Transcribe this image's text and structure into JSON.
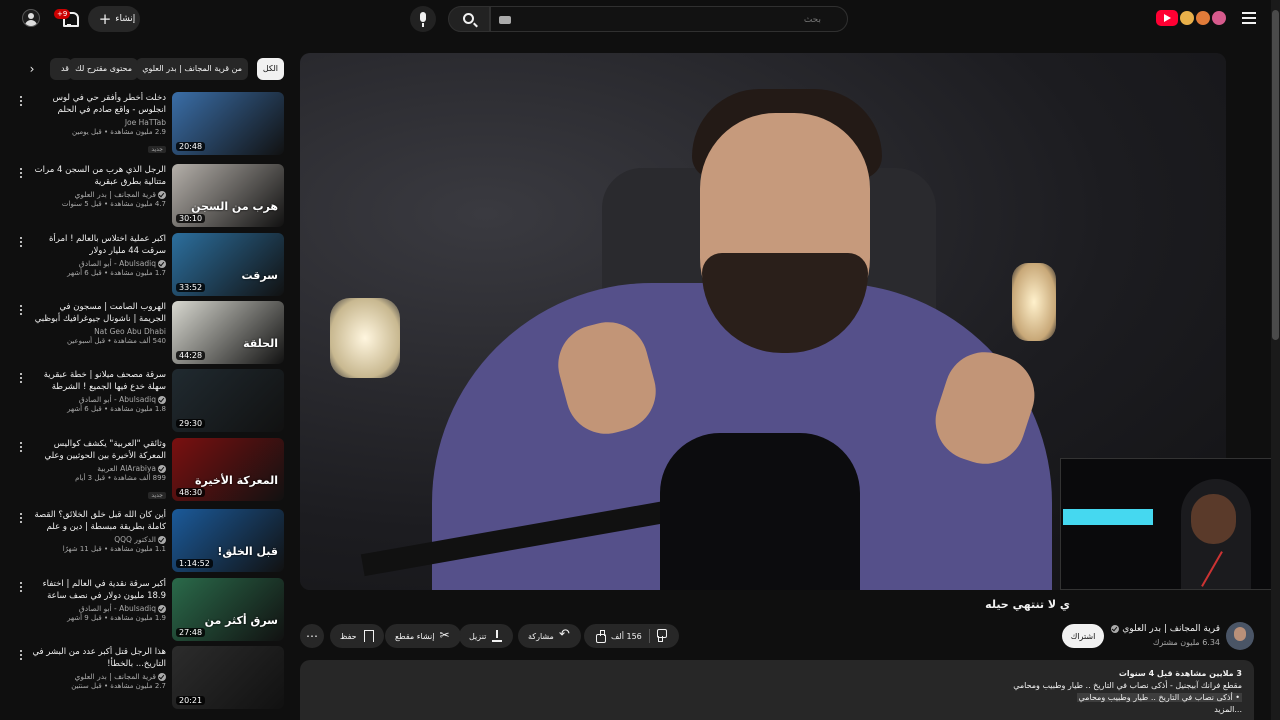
{
  "header": {
    "search_placeholder": "بحث",
    "create_label": "إنشاء",
    "notif_count": "9+"
  },
  "chips": [
    "الكل",
    "من قرية المجانف | بدر العلوي",
    "محتوى مقترح لك",
    "قد"
  ],
  "video": {
    "title": "ي لا تنتهي حيله",
    "channel": "قرية المجانف | بدر العلوي",
    "subscribers": "6.34 مليون مشترك",
    "subscribe_label": "اشتراك",
    "likes": "156 ألف",
    "share_label": "مشاركة",
    "download_label": "تنزيل",
    "clip_label": "إنشاء مقطع",
    "save_label": "حفظ"
  },
  "description": {
    "stats": "3 ملايين مشاهدة  قبل 4 سنوات",
    "line1": "مقطع فرانك آبيجنيل - أذكى نصاب في التاريخ .. طيار وطبيب ومحامي",
    "line2": "• أذكى نصاب في التاريخ .. طيار وطبيب ومحامي",
    "more": "...المزيد"
  },
  "recommendations": [
    {
      "title": "دخلت أخطر وأفقر حي في لوس انجلوس - واقع صادم في الحلم الأمريكي 🇺🇸",
      "channel": "Joe HaTTab",
      "verified": false,
      "meta": "2.9 مليون مشاهدة • قبل يومين",
      "duration": "20:48",
      "new": "جديد",
      "thumb_color": "#3a6ea8",
      "thumb_text": ""
    },
    {
      "title": "الرجل الذي هرب من السجن 4 مرات متتالية بطرق عبقرية",
      "channel": "قرية المجانف | بدر العلوي",
      "verified": true,
      "meta": "4.7 مليون مشاهدة • قبل 5 سنوات",
      "duration": "30:10",
      "new": "",
      "thumb_color": "#b5b0aa",
      "thumb_text": "هرب من السجن"
    },
    {
      "title": "اكبر عملية اختلاس بالعالم ! امرأة سرقت 44 مليار دولار",
      "channel": "Abulsadiq - أبو الصادق",
      "verified": true,
      "meta": "1.7 مليون مشاهدة • قبل 6 أشهر",
      "duration": "33:52",
      "new": "",
      "thumb_color": "#2c6f9e",
      "thumb_text": "سرقت"
    },
    {
      "title": "الهروب الصامت | مسجون في الجريمة | ناشونال جيوغرافيك أبوظبي",
      "channel": "Nat Geo Abu Dhabi",
      "verified": false,
      "meta": "540 ألف مشاهدة • قبل أسبوعين",
      "duration": "44:28",
      "new": "",
      "thumb_color": "#d8d8d0",
      "thumb_text": "الحلقة"
    },
    {
      "title": "سرقة مصحف ميلانو | خطة عبقرية سهلة خدع فيها الجميع ! الشرطة والمصرفية",
      "channel": "Abulsadiq - أبو الصادق",
      "verified": true,
      "meta": "1.8 مليون مشاهدة • قبل 6 أشهر",
      "duration": "29:30",
      "new": "",
      "thumb_color": "#202a30",
      "thumb_text": ""
    },
    {
      "title": "وثائقي \"العربية\" يكشف كواليس المعركة الأخيرة بين الحوثيين وعلي عبد الله صالح",
      "channel": "AlArabiya العربية",
      "verified": true,
      "meta": "899 ألف مشاهدة • قبل 3 أيام",
      "duration": "48:30",
      "new": "جديد",
      "thumb_color": "#7a1010",
      "thumb_text": "المعركة الأخيرة"
    },
    {
      "title": "أين كان الله قبل خلق الخلائق؟ القصة كاملة بطريقة مبسطة | دين و علم",
      "channel": "الدكتور QQQ",
      "verified": true,
      "meta": "1.1 مليون مشاهدة • قبل 11 شهرًا",
      "duration": "1:14:52",
      "new": "",
      "thumb_color": "#1b5a9a",
      "thumb_text": "قبل الخلق!"
    },
    {
      "title": "أكبر سرقة نقدية في العالم | اختفاء 18.9 مليون دولار في نصف ساعة",
      "channel": "Abulsadiq - أبو الصادق",
      "verified": true,
      "meta": "1.9 مليون مشاهدة • قبل 9 أشهر",
      "duration": "27:48",
      "new": "",
      "thumb_color": "#2a6a4a",
      "thumb_text": "سرق أكثر من"
    },
    {
      "title": "هذا الرجل قتل أكبر عدد من البشر في التاريخ... بالخطأ!",
      "channel": "قرية المجانف | بدر العلوي",
      "verified": true,
      "meta": "2.7 مليون مشاهدة • قبل سنتين",
      "duration": "20:21",
      "new": "",
      "thumb_color": "#2c2c2c",
      "thumb_text": ""
    }
  ]
}
